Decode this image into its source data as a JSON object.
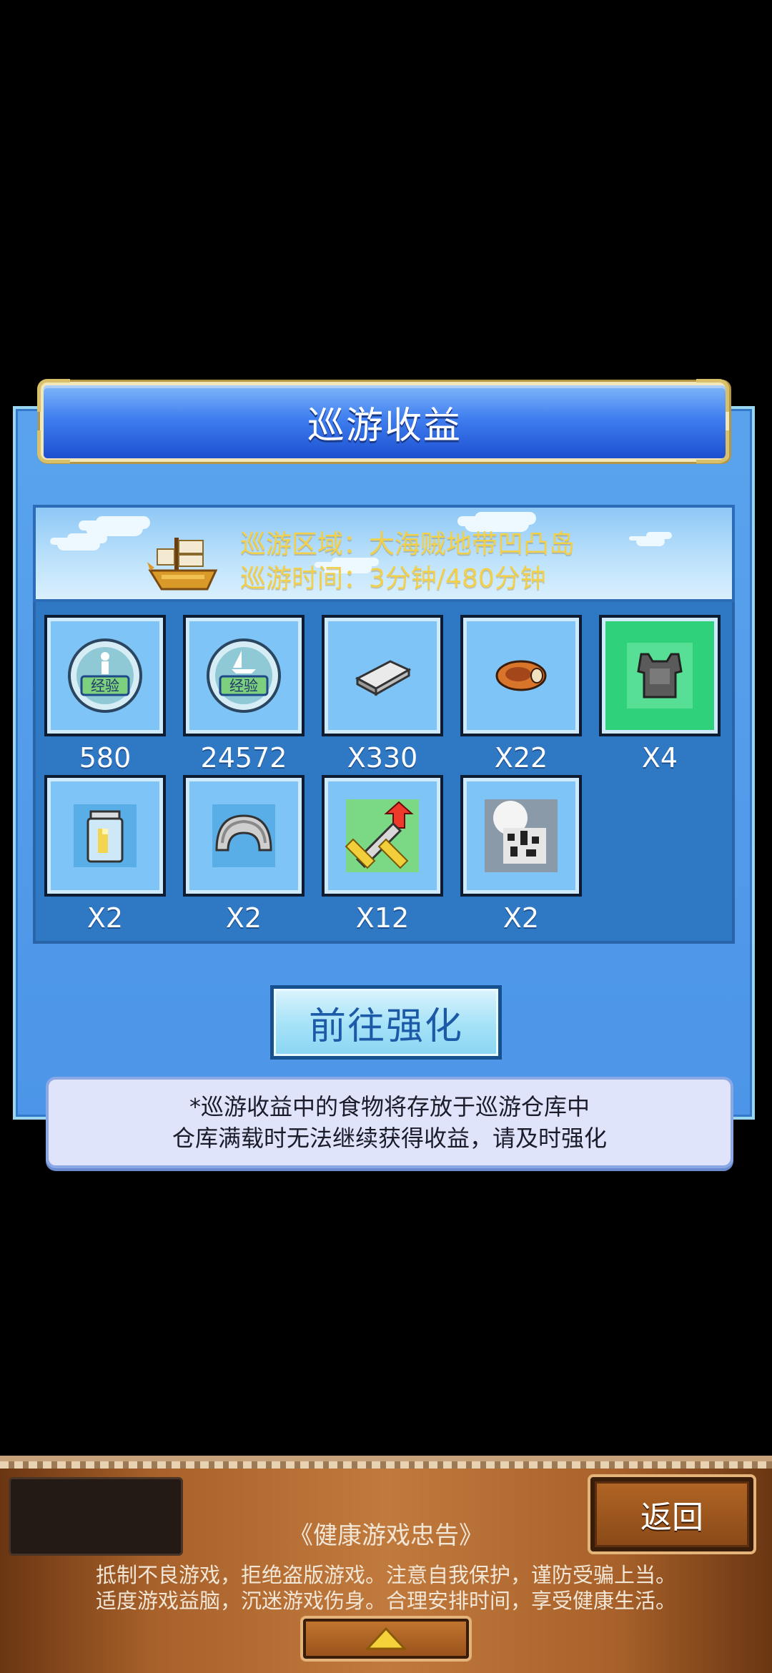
{
  "dialog": {
    "title": "巡游收益",
    "region_line": "巡游区域：大海贼地带凹凸岛",
    "time_line": "巡游时间：3分钟/480分钟"
  },
  "rewards": [
    {
      "label": "580",
      "icon": "person-exp-icon"
    },
    {
      "label": "24572",
      "icon": "ship-exp-icon"
    },
    {
      "label": "X330",
      "icon": "iron-ingot-icon"
    },
    {
      "label": "X22",
      "icon": "roast-meat-icon"
    },
    {
      "label": "X4",
      "icon": "armor-icon"
    },
    {
      "label": "X2",
      "icon": "jar-icon"
    },
    {
      "label": "X2",
      "icon": "helmet-icon"
    },
    {
      "label": "X12",
      "icon": "sword-upgrade-icon"
    },
    {
      "label": "X2",
      "icon": "secret-item-icon"
    }
  ],
  "buttons": {
    "go_enhance": "前往强化",
    "back": "返回"
  },
  "note": {
    "line1": "*巡游收益中的食物将存放于巡游仓库中",
    "line2": "仓库满载时无法继续获得收益，请及时强化"
  },
  "health_notice": {
    "title": "《健康游戏忠告》",
    "line1": "抵制不良游戏，拒绝盗版游戏。注意自我保护，谨防受骗上当。",
    "line2": "适度游戏益脑，沉迷游戏伤身。合理安排时间，享受健康生活。"
  },
  "colors": {
    "info_text": "#f3d04a",
    "panel_blue": "#4c95e8",
    "title_blue": "#2a5fe0"
  }
}
